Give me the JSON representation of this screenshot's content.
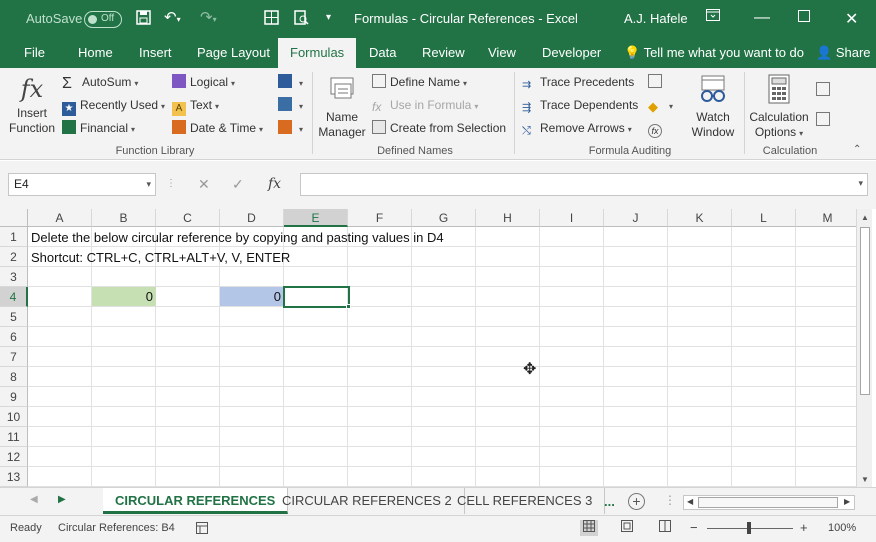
{
  "titlebar": {
    "autosave_label": "AutoSave",
    "autosave_state": "Off",
    "title": "Formulas - Circular References  -  Excel",
    "user": "A.J. Hafele",
    "icons": [
      "save-icon",
      "undo-icon",
      "redo-icon",
      "table-icon",
      "print-preview-icon",
      "customize-qat-icon",
      "ribbon-display-icon",
      "minimize-icon",
      "maximize-icon",
      "close-icon"
    ]
  },
  "tabs": {
    "items": [
      "File",
      "Home",
      "Insert",
      "Page Layout",
      "Formulas",
      "Data",
      "Review",
      "View",
      "Developer"
    ],
    "active": "Formulas",
    "tellme": "Tell me what you want to do",
    "share": "Share"
  },
  "ribbon": {
    "function_library": {
      "label": "Function Library",
      "insert_function_line1": "Insert",
      "insert_function_line2": "Function",
      "autosum": "AutoSum",
      "recently_used": "Recently Used",
      "financial": "Financial",
      "logical": "Logical",
      "text": "Text",
      "date_time": "Date & Time"
    },
    "defined_names": {
      "label": "Defined Names",
      "name_manager_line1": "Name",
      "name_manager_line2": "Manager",
      "define_name": "Define Name",
      "use_in_formula": "Use in Formula",
      "create_from_selection": "Create from Selection"
    },
    "formula_auditing": {
      "label": "Formula Auditing",
      "trace_precedents": "Trace Precedents",
      "trace_dependents": "Trace Dependents",
      "remove_arrows": "Remove Arrows",
      "watch_window_line1": "Watch",
      "watch_window_line2": "Window"
    },
    "calculation": {
      "label": "Calculation",
      "calc_options_line1": "Calculation",
      "calc_options_line2": "Options"
    }
  },
  "formula_bar": {
    "name_box": "E4",
    "cancel_symbol": "✕",
    "enter_symbol": "✓",
    "fx_symbol": "fx",
    "formula": ""
  },
  "grid": {
    "columns": [
      "A",
      "B",
      "C",
      "D",
      "E",
      "F",
      "G",
      "H",
      "I",
      "J",
      "K",
      "L",
      "M"
    ],
    "rows": [
      "1",
      "2",
      "3",
      "4",
      "5",
      "6",
      "7",
      "8",
      "9",
      "10",
      "11",
      "12",
      "13"
    ],
    "selected_column": "E",
    "selected_row": "4",
    "a1": "Delete the below circular reference by copying and pasting values in D4",
    "a2": "Shortcut: CTRL+C, CTRL+ALT+V, V, ENTER",
    "b4": "0",
    "d4": "0",
    "b4_color": "#c6e0b4",
    "d4_color": "#b4c6e7"
  },
  "sheets": {
    "tabs": [
      "CIRCULAR REFERENCES",
      "CIRCULAR REFERENCES 2",
      "CELL REFERENCES 3"
    ],
    "active": "CIRCULAR REFERENCES",
    "more": "..."
  },
  "status": {
    "ready": "Ready",
    "circular": "Circular References: B4",
    "zoom": "100%"
  },
  "colors": {
    "accent": "#217346"
  }
}
